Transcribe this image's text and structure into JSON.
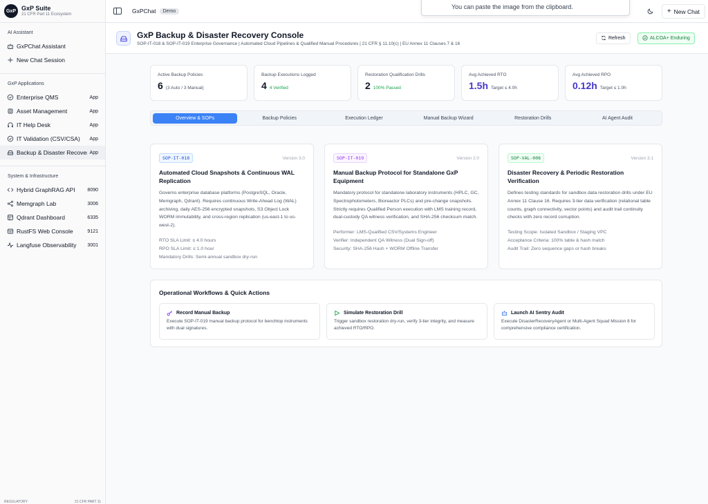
{
  "brand": {
    "logo": "GxP",
    "name": "GxP Suite",
    "subtitle": "21 CFR Part 11 Ecosystem"
  },
  "sidebar": {
    "ai_section": "AI Assistant",
    "ai_items": [
      {
        "label": "GxPChat Assistant",
        "icon": "bot-icon"
      },
      {
        "label": "New Chat Session",
        "icon": "plus-icon"
      }
    ],
    "apps_section": "GxP Applications",
    "apps_items": [
      {
        "label": "Enterprise QMS",
        "badge": "App",
        "icon": "shield-check-icon"
      },
      {
        "label": "Asset Management",
        "badge": "App",
        "icon": "cpu-icon"
      },
      {
        "label": "IT Help Desk",
        "badge": "App",
        "icon": "headphones-icon"
      },
      {
        "label": "IT Validation (CSV/CSA)",
        "badge": "App",
        "icon": "check-circle-icon"
      },
      {
        "label": "Backup & Disaster Recovery",
        "badge": "App",
        "icon": "hard-drive-icon"
      }
    ],
    "infra_section": "System & Infrastructure",
    "infra_items": [
      {
        "label": "Hybrid GraphRAG API",
        "badge": "8090",
        "icon": "code-icon"
      },
      {
        "label": "Memgraph Lab",
        "badge": "3006",
        "icon": "share-nodes-icon"
      },
      {
        "label": "Qdrant Dashboard",
        "badge": "6335",
        "icon": "database-icon"
      },
      {
        "label": "RustFS Web Console",
        "badge": "9121",
        "icon": "server-icon"
      },
      {
        "label": "Langfuse Observability",
        "badge": "3001",
        "icon": "activity-icon"
      }
    ],
    "footer_left": "REGULATORY",
    "footer_right": "21 CFR PART 11"
  },
  "topbar": {
    "title": "GxPChat",
    "badge": "Demo",
    "toast": "You can paste the image from the clipboard.",
    "new_chat": "New Chat"
  },
  "header": {
    "title": "GxP Backup & Disaster Recovery Console",
    "subtitle": "SOP-IT-018 & SOP-IT-019 Enterprise Governance | Automated Cloud Pipelines & Qualified Manual Procedures | 21 CFR § 11.10(c) | EU Annex 11 Clauses 7 & 16",
    "refresh": "Refresh",
    "alcoa": "ALCOA+ Enduring"
  },
  "stats": [
    {
      "label": "Active Backup Policies",
      "value": "6",
      "note": "(3 Auto / 3 Manual)"
    },
    {
      "label": "Backup Executions Logged",
      "value": "4",
      "note": "4 Verified"
    },
    {
      "label": "Restoration Qualification Drills",
      "value": "2",
      "note": "100% Passed"
    },
    {
      "label": "Avg Achieved RTO",
      "value": "1.5h",
      "note": "Target ≤ 4.0h"
    },
    {
      "label": "Avg Achieved RPO",
      "value": "0.12h",
      "note": "Target ≤ 1.0h"
    }
  ],
  "tabs": [
    "Overview & SOPs",
    "Backup Policies",
    "Execution Ledger",
    "Manual Backup Wizard",
    "Restoration Drills",
    "AI Agent Audit"
  ],
  "sops": [
    {
      "code": "SOP-IT-018",
      "version": "Version 3.0",
      "title": "Automated Cloud Snapshots & Continuous WAL Replication",
      "desc": "Governs enterprise database platforms (PostgreSQL, Oracle, Memgraph, Qdrant). Requires continuous Write-Ahead Log (WAL) archiving, daily AES-256 encrypted snapshots, S3 Object Lock WORM immutability, and cross-region replication (us-east-1 to us-west-2).",
      "meta": [
        "RTO SLA Limit: ≤ 4.0 hours",
        "RPO SLA Limit: ≤ 1.0 hour",
        "Mandatory Drills: Semi-annual sandbox dry-run"
      ]
    },
    {
      "code": "SOP-IT-019",
      "version": "Version 2.0",
      "title": "Manual Backup Protocol for Standalone GxP Equipment",
      "desc": "Mandatory protocol for standalone laboratory instruments (HPLC, GC, Spectrophotometers, Bioreactor PLCs) and pre-change snapshots. Strictly requires Qualified Person execution with LMS training record, dual-custody QA witness verification, and SHA-256 checksum match.",
      "meta": [
        "Performer: LMS-Qualified CSV/Systems Engineer",
        "Verifier: Independent QA Witness (Dual Sign-off)",
        "Security: SHA-256 Hash + WORM Offline Transfer"
      ]
    },
    {
      "code": "SOP-VAL-008",
      "version": "Version 3.1",
      "title": "Disaster Recovery & Periodic Restoration Verification",
      "desc": "Defines testing standards for sandbox data restoration drills under EU Annex 11 Clause 16. Requires 3-tier data verification (relational table counts, graph connectivity, vector points) and audit trail continuity checks with zero record corruption.",
      "meta": [
        "Testing Scope: Isolated Sandbox / Staging VPC",
        "Acceptance Criteria: 100% table & hash match",
        "Audit Trail: Zero sequence gaps or hash breaks"
      ]
    }
  ],
  "workflows": {
    "title": "Operational Workflows & Quick Actions",
    "items": [
      {
        "title": "Record Manual Backup",
        "desc": "Execute SOP-IT-019 manual backup protocol for benchtop instruments with dual signatures.",
        "icon": "key-icon"
      },
      {
        "title": "Simulate Restoration Drill",
        "desc": "Trigger sandbox restoration dry-run, verify 3-tier integrity, and measure achieved RTO/RPO.",
        "icon": "play-icon"
      },
      {
        "title": "Launch AI Sentry Audit",
        "desc": "Execute DisasterRecoveryAgent or Multi-Agent Squad Mission 8 for comprehensive compliance certification.",
        "icon": "bot-icon"
      }
    ]
  }
}
